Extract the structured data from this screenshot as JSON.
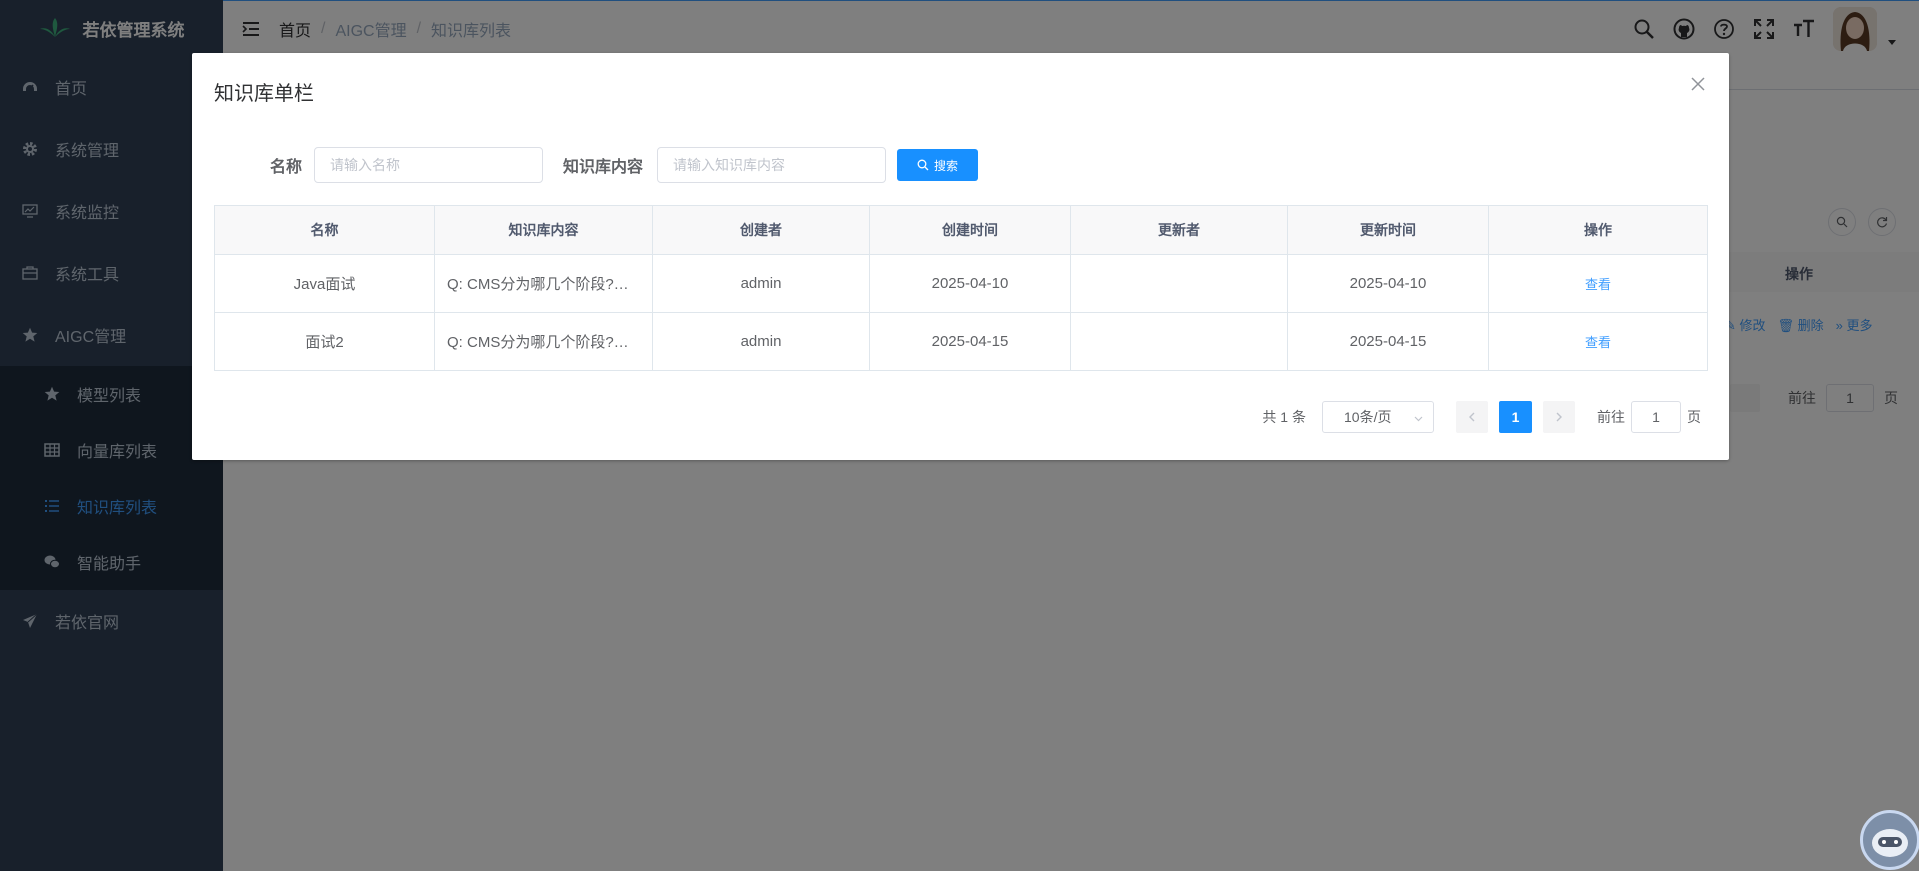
{
  "app": {
    "title": "若依管理系统"
  },
  "sidebar": {
    "items": [
      {
        "label": "首页",
        "icon": "dashboard-icon"
      },
      {
        "label": "系统管理",
        "icon": "gear-icon"
      },
      {
        "label": "系统监控",
        "icon": "monitor-icon"
      },
      {
        "label": "系统工具",
        "icon": "toolbox-icon"
      },
      {
        "label": "AIGC管理",
        "icon": "star-icon"
      }
    ],
    "submenu": [
      {
        "label": "模型列表",
        "icon": "star-icon"
      },
      {
        "label": "向量库列表",
        "icon": "grid-icon"
      },
      {
        "label": "知识库列表",
        "icon": "list-icon",
        "active": true
      },
      {
        "label": "智能助手",
        "icon": "chat-icon"
      }
    ],
    "footer_item": {
      "label": "若依官网",
      "icon": "send-icon"
    }
  },
  "breadcrumb": [
    "首页",
    "AIGC管理",
    "知识库列表"
  ],
  "background": {
    "table_header_ops": "操作",
    "actions": [
      "修改",
      "删除",
      "更多"
    ],
    "goto_label": "前往",
    "goto_value": "1",
    "page_suffix": "页"
  },
  "dialog": {
    "title": "知识库单栏",
    "form": {
      "name_label": "名称",
      "name_placeholder": "请输入名称",
      "content_label": "知识库内容",
      "content_placeholder": "请输入知识库内容",
      "search_label": "搜索"
    },
    "table": {
      "columns": [
        "名称",
        "知识库内容",
        "创建者",
        "创建时间",
        "更新者",
        "更新时间",
        "操作"
      ],
      "rows": [
        {
          "name": "Java面试",
          "content": "Q: CMS分为哪几个阶段?…",
          "creator": "admin",
          "created": "2025-04-10",
          "updater": "",
          "updated": "2025-04-10",
          "action": "查看"
        },
        {
          "name": "面试2",
          "content": "Q: CMS分为哪几个阶段?…",
          "creator": "admin",
          "created": "2025-04-15",
          "updater": "",
          "updated": "2025-04-15",
          "action": "查看"
        }
      ]
    },
    "pagination": {
      "total_text": "共 1 条",
      "page_size": "10条/页",
      "current_page": "1",
      "goto_label": "前往",
      "goto_value": "1",
      "page_suffix": "页"
    }
  },
  "colors": {
    "sidebar_bg": "#304156",
    "submenu_bg": "#1f2d3d",
    "accent": "#1890ff",
    "link": "#409eff"
  }
}
